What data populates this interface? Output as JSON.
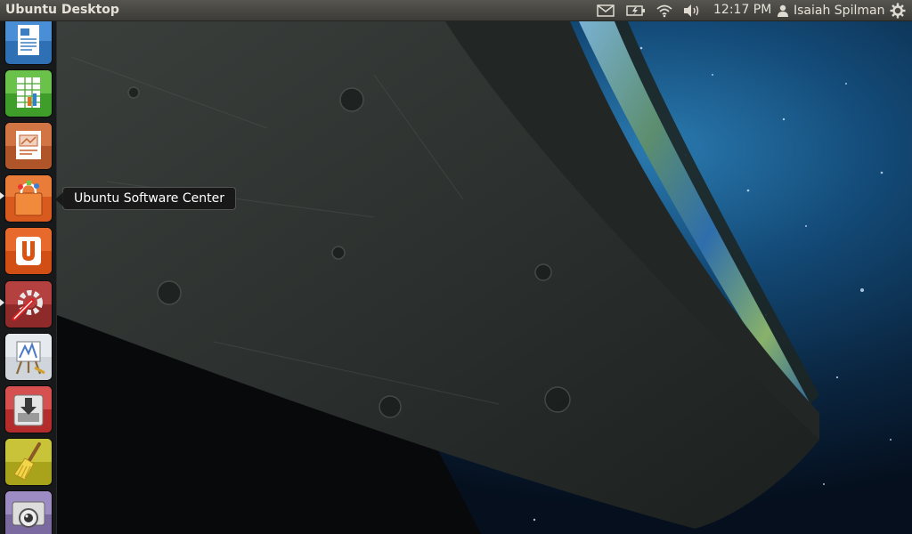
{
  "panel": {
    "window_title": "Ubuntu Desktop",
    "clock": "12:17 PM",
    "user_name": "Isaiah Spilman",
    "indicators": [
      "mail-icon",
      "battery-icon",
      "wifi-icon",
      "volume-icon"
    ],
    "session_icon": "gear-icon"
  },
  "launcher": {
    "items": [
      {
        "name": "LibreOffice Writer",
        "icon": "document-icon",
        "running": false
      },
      {
        "name": "LibreOffice Calc",
        "icon": "spreadsheet-icon",
        "running": false
      },
      {
        "name": "LibreOffice Impress",
        "icon": "presentation-icon",
        "running": false
      },
      {
        "name": "Ubuntu Software Center",
        "icon": "shopping-bag-icon",
        "running": true,
        "hovered": true
      },
      {
        "name": "Ubuntu One",
        "icon": "ubuntu-one-icon",
        "running": false
      },
      {
        "name": "System Settings",
        "icon": "settings-icon",
        "running": true
      },
      {
        "name": "Drawing app",
        "icon": "easel-icon",
        "running": false
      },
      {
        "name": "Download manager",
        "icon": "download-icon",
        "running": false
      },
      {
        "name": "Cleaner",
        "icon": "broom-icon",
        "running": false
      },
      {
        "name": "Webcam app",
        "icon": "webcam-icon",
        "running": false
      }
    ]
  },
  "tooltip": {
    "text": "Ubuntu Software Center"
  },
  "colors": {
    "panel": "#3c3b37",
    "launcher": "#1c1c1a",
    "space": "#0b2a44",
    "ring": "#2e3331"
  }
}
